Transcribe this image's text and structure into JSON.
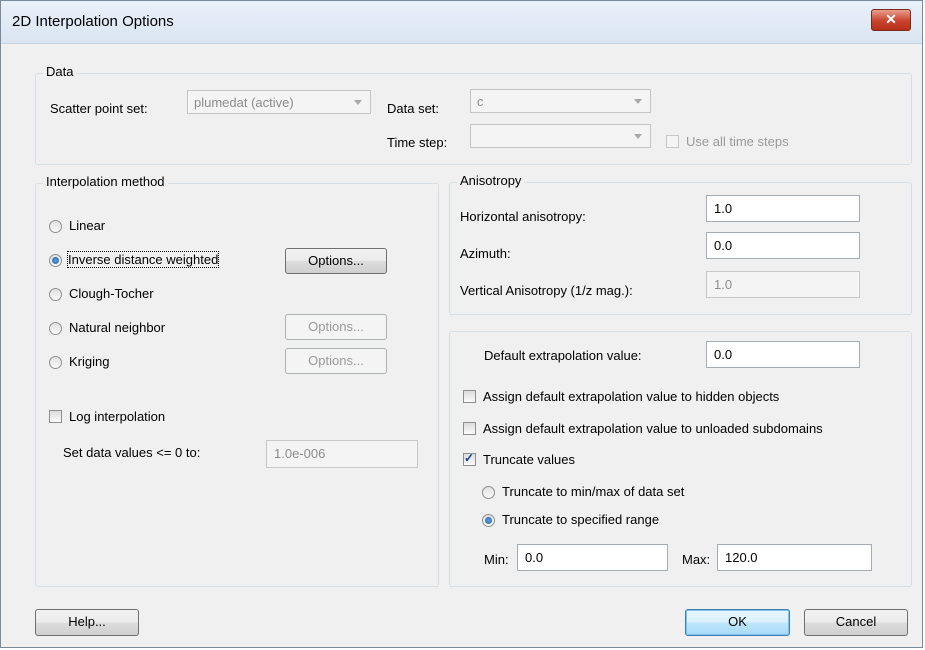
{
  "window": {
    "title": "2D Interpolation Options"
  },
  "data_group": {
    "label": "Data",
    "scatter_label": "Scatter point set:",
    "scatter_value": "plumedat (active)",
    "dataset_label": "Data set:",
    "dataset_value": "c",
    "timestep_label": "Time step:",
    "timestep_value": "",
    "use_all_label": "Use all time steps"
  },
  "method_group": {
    "label": "Interpolation method",
    "options": [
      {
        "label": "Linear",
        "selected": false
      },
      {
        "label": "Inverse distance weighted",
        "selected": true
      },
      {
        "label": "Clough-Tocher",
        "selected": false
      },
      {
        "label": "Natural neighbor",
        "selected": false
      },
      {
        "label": "Kriging",
        "selected": false
      }
    ],
    "options_button": "Options...",
    "log_label": "Log interpolation",
    "set_data_label": "Set data values <= 0 to:",
    "set_data_value": "1.0e-006"
  },
  "anisotropy_group": {
    "label": "Anisotropy",
    "horizontal_label": "Horizontal anisotropy:",
    "horizontal_value": "1.0",
    "azimuth_label": "Azimuth:",
    "azimuth_value": "0.0",
    "vertical_label": "Vertical Anisotropy (1/z mag.):",
    "vertical_value": "1.0"
  },
  "extrapolation_group": {
    "default_label": "Default extrapolation value:",
    "default_value": "0.0",
    "hidden_label": "Assign default extrapolation value to hidden objects",
    "unloaded_label": "Assign default extrapolation value to unloaded subdomains",
    "truncate_label": "Truncate values",
    "truncate_minmax_label": "Truncate to min/max of data set",
    "truncate_range_label": "Truncate to specified range",
    "min_label": "Min:",
    "min_value": "0.0",
    "max_label": "Max:",
    "max_value": "120.0"
  },
  "footer": {
    "help": "Help...",
    "ok": "OK",
    "cancel": "Cancel"
  }
}
